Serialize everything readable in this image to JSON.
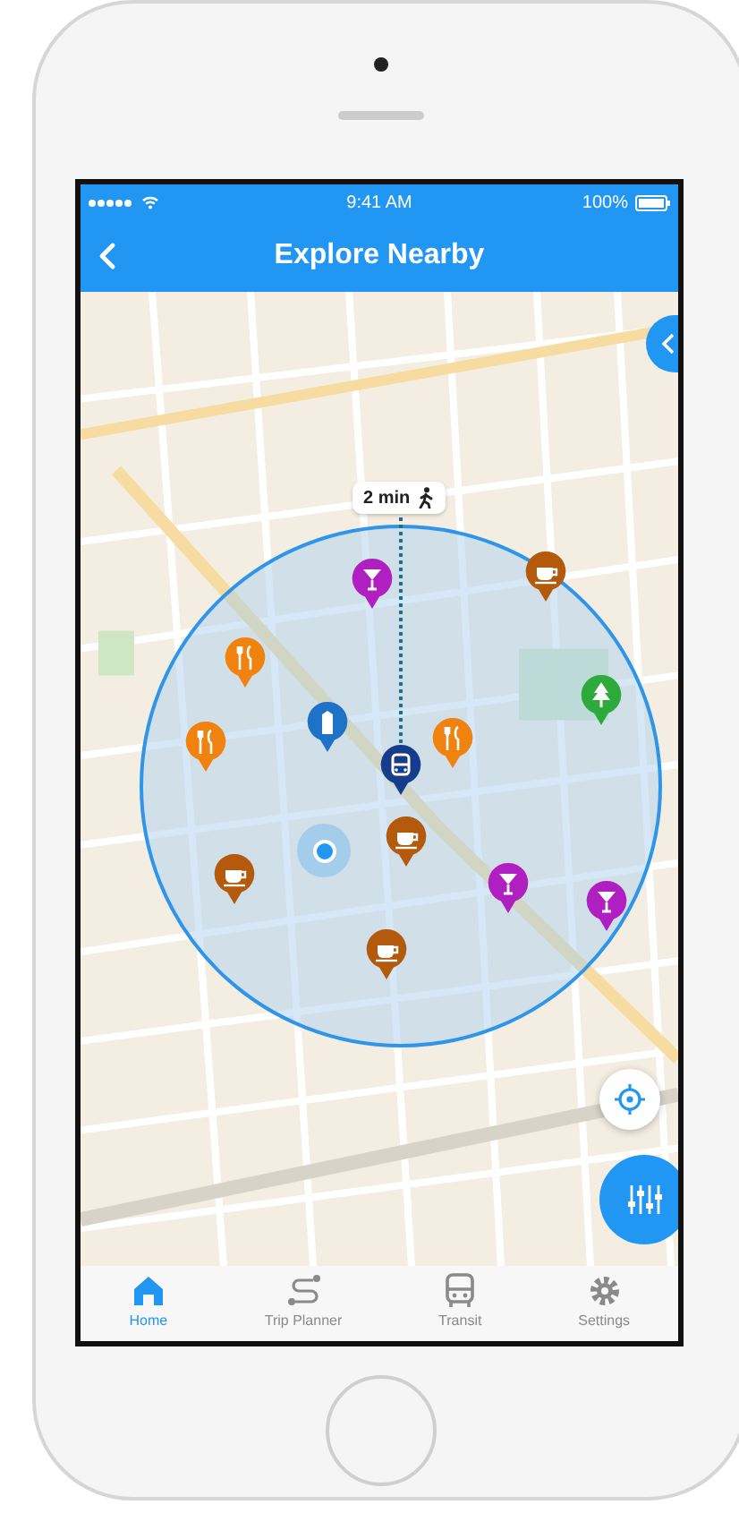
{
  "status_bar": {
    "time": "9:41 AM",
    "battery": "100%"
  },
  "nav_bar": {
    "title": "Explore Nearby"
  },
  "map": {
    "walk_time": "2 min",
    "pins": [
      {
        "kind": "bar"
      },
      {
        "kind": "cafe"
      },
      {
        "kind": "restaurant"
      },
      {
        "kind": "building"
      },
      {
        "kind": "restaurant"
      },
      {
        "kind": "bus"
      },
      {
        "kind": "restaurant"
      },
      {
        "kind": "park"
      },
      {
        "kind": "cafe"
      },
      {
        "kind": "cafe"
      },
      {
        "kind": "bar"
      },
      {
        "kind": "bar"
      },
      {
        "kind": "cafe"
      }
    ]
  },
  "tabs": [
    {
      "label": "Home",
      "selected": true,
      "kind": "home"
    },
    {
      "label": "Trip Planner",
      "selected": false,
      "kind": "route"
    },
    {
      "label": "Transit",
      "selected": false,
      "kind": "bus"
    },
    {
      "label": "Settings",
      "selected": false,
      "kind": "gear"
    }
  ]
}
